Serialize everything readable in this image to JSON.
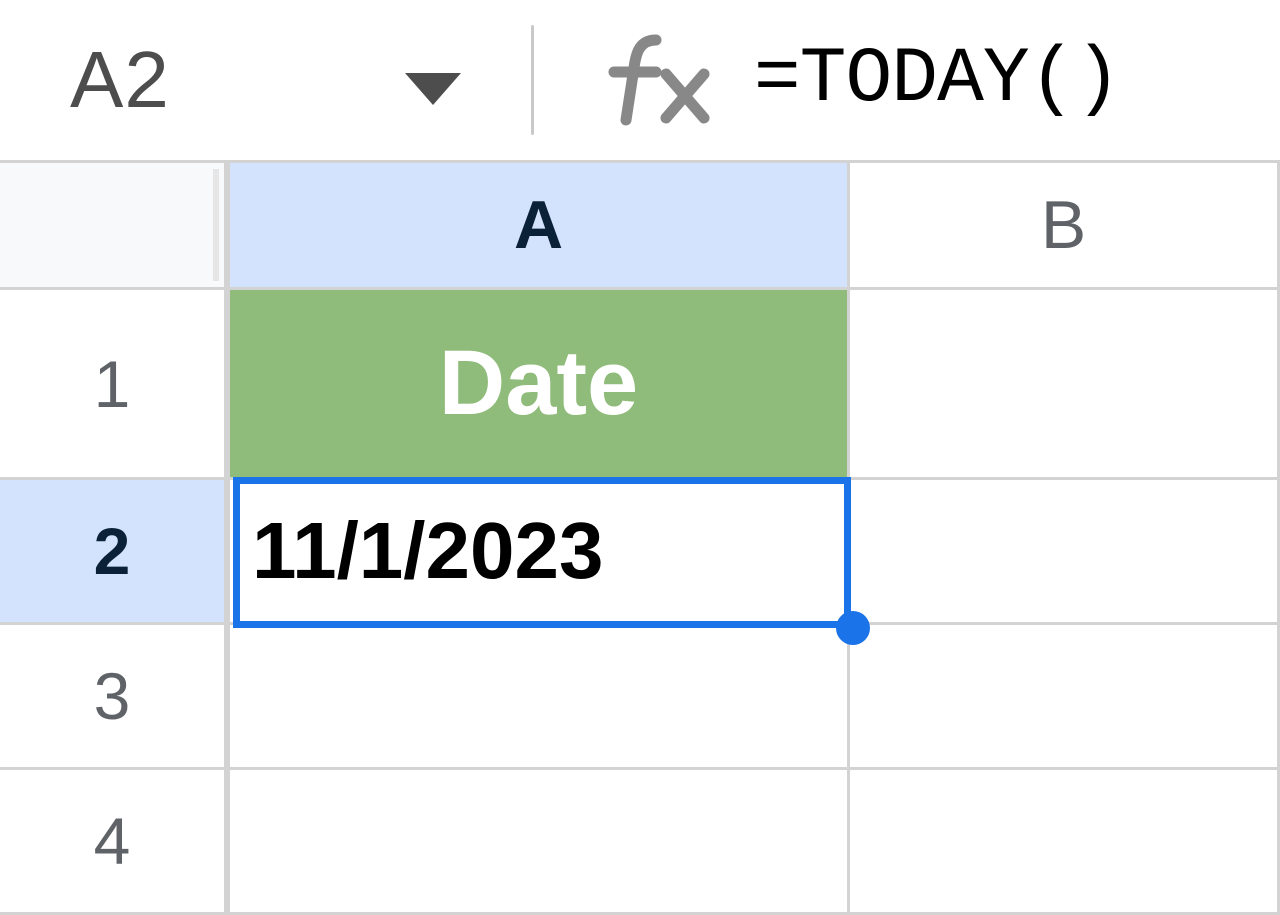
{
  "formula_bar": {
    "name_box": "A2",
    "formula": "=TODAY()"
  },
  "columns": {
    "A": "A",
    "B": "B"
  },
  "rows": {
    "r1": "1",
    "r2": "2",
    "r3": "3",
    "r4": "4"
  },
  "cells": {
    "A1": "Date",
    "A2": "11/1/2023"
  },
  "selection": {
    "active_cell": "A2"
  },
  "colors": {
    "selection_border": "#1a73e8",
    "selected_header_bg": "#d3e3fd",
    "cell_header_green": "#8fbc7a"
  }
}
